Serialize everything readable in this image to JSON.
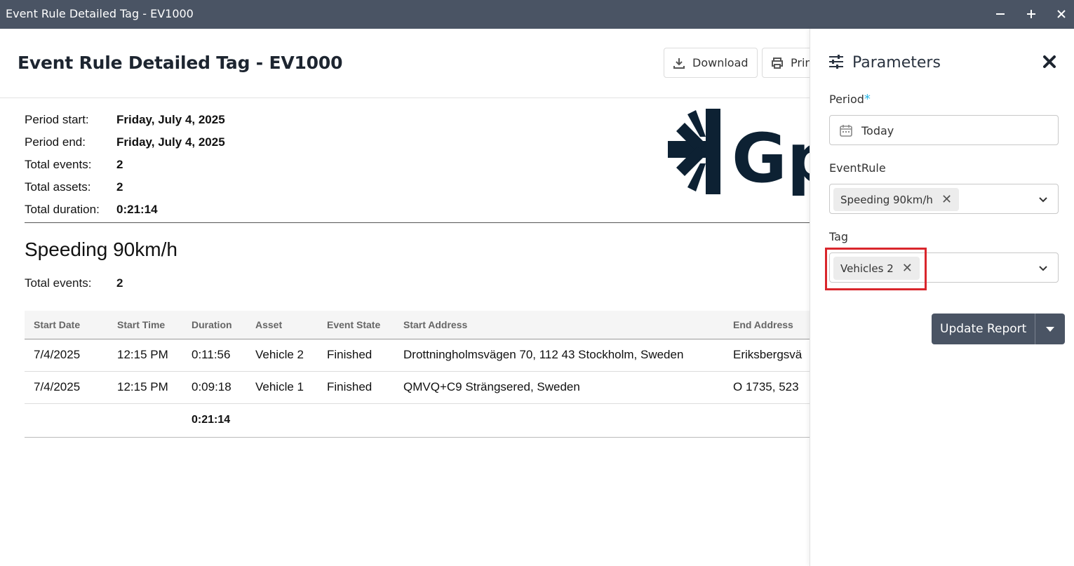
{
  "window": {
    "title": "Event Rule Detailed Tag - EV1000",
    "controls": [
      "minimize",
      "maximize",
      "close"
    ]
  },
  "header": {
    "title": "Event Rule Detailed Tag - EV1000",
    "download_label": "Download",
    "print_label": "Prin"
  },
  "summary": {
    "rows": [
      {
        "label": "Period start:",
        "value": "Friday, July 4, 2025"
      },
      {
        "label": "Period end:",
        "value": "Friday, July 4, 2025"
      },
      {
        "label": "Total events:",
        "value": "2"
      },
      {
        "label": "Total assets:",
        "value": "2"
      },
      {
        "label": "Total duration:",
        "value": "0:21:14"
      }
    ]
  },
  "logo": {
    "text": "Gp",
    "color": "#0d2133"
  },
  "section": {
    "title": "Speeding 90km/h",
    "total_label": "Total events:",
    "total_value": "2"
  },
  "table": {
    "columns": [
      "Start Date",
      "Start Time",
      "Duration",
      "Asset",
      "Event State",
      "Start Address",
      "End Address"
    ],
    "rows": [
      [
        "7/4/2025",
        "12:15 PM",
        "0:11:56",
        "Vehicle 2",
        "Finished",
        "Drottningholmsvägen 70, 112 43 Stockholm, Sweden",
        "Eriksbergsvä"
      ],
      [
        "7/4/2025",
        "12:15 PM",
        "0:09:18",
        "Vehicle 1",
        "Finished",
        "QMVQ+C9 Strängsered, Sweden",
        "O 1735, 523"
      ]
    ],
    "total_duration": "0:21:14"
  },
  "panel": {
    "title": "Parameters",
    "period_label": "Period",
    "period_required": "*",
    "period_value": "Today",
    "eventrule_label": "EventRule",
    "eventrule_chip": "Speeding 90km/h",
    "tag_label": "Tag",
    "tag_chip": "Vehicles 2",
    "update_label": "Update Report"
  },
  "colors": {
    "titlebar": "#4a5464",
    "accent": "#29b6e6",
    "highlight": "#d9262c"
  }
}
